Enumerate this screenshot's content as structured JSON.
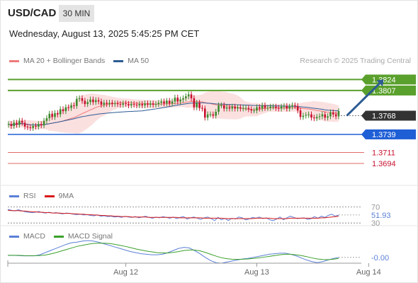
{
  "header": {
    "symbol": "USD/CAD",
    "timeframe": "30 MIN",
    "datetime": "Wednesday, August 13, 2025 5:45:25 PM CET",
    "research": "Research © 2025 Trading Central"
  },
  "legends": {
    "price": [
      {
        "label": "MA 20 + Bollinger Bands",
        "color": "#f07a7a"
      },
      {
        "label": "MA 50",
        "color": "#2d5b94"
      }
    ],
    "rsi": [
      {
        "label": "RSI",
        "color": "#5b7fd6"
      },
      {
        "label": "9MA",
        "color": "#d81a1a"
      }
    ],
    "macd": [
      {
        "label": "MACD",
        "color": "#5b7fd6"
      },
      {
        "label": "MACD Signal",
        "color": "#3aa02a"
      }
    ]
  },
  "colors": {
    "up": "#3c8a2e",
    "down": "#c8102e",
    "band": "#f9d6d6",
    "resistance": "#5aa02c",
    "current": "#333333",
    "support_blue": "#1f5fd6",
    "support_red": "#e06a6a",
    "arrow": "#2d5b94"
  },
  "chart_data": [
    {
      "type": "candlestick",
      "title": "USD/CAD",
      "ylim": [
        1.366,
        1.3842
      ],
      "x_ticks": [
        {
          "label": "Aug 12",
          "index": 43
        },
        {
          "label": "Aug 13",
          "index": 91
        },
        {
          "label": "Aug 14",
          "index": 132
        }
      ],
      "levels": [
        {
          "value": 1.3824,
          "label": "1.3824",
          "kind": "resistance"
        },
        {
          "value": 1.3807,
          "label": "1.3807",
          "kind": "resistance"
        },
        {
          "value": 1.3768,
          "label": "1.3768",
          "kind": "current"
        },
        {
          "value": 1.3739,
          "label": "1.3739",
          "kind": "support_blue"
        },
        {
          "value": 1.3711,
          "label": "1.3711",
          "kind": "support_red"
        },
        {
          "value": 1.3694,
          "label": "1.3694",
          "kind": "support_red"
        }
      ],
      "closes": [
        1.3755,
        1.3752,
        1.3757,
        1.3754,
        1.376,
        1.3757,
        1.3751,
        1.375,
        1.3749,
        1.3752,
        1.3751,
        1.3755,
        1.3753,
        1.376,
        1.3764,
        1.3771,
        1.3766,
        1.3772,
        1.377,
        1.3778,
        1.3775,
        1.3781,
        1.378,
        1.3784,
        1.3783,
        1.3794,
        1.3795,
        1.3791,
        1.3786,
        1.3789,
        1.3793,
        1.3789,
        1.3792,
        1.379,
        1.3785,
        1.3788,
        1.3786,
        1.3788,
        1.3786,
        1.3787,
        1.3786,
        1.3785,
        1.3787,
        1.3786,
        1.3784,
        1.3786,
        1.3785,
        1.3784,
        1.3786,
        1.3784,
        1.3787,
        1.3785,
        1.3787,
        1.3785,
        1.3786,
        1.3788,
        1.379,
        1.3787,
        1.3791,
        1.3787,
        1.379,
        1.3796,
        1.379,
        1.3793,
        1.3795,
        1.3798,
        1.3801,
        1.3795,
        1.3781,
        1.3788,
        1.378,
        1.3779,
        1.3765,
        1.377,
        1.377,
        1.3768,
        1.3774,
        1.3784,
        1.3784,
        1.3779,
        1.3781,
        1.3779,
        1.3782,
        1.3779,
        1.3781,
        1.3779,
        1.378,
        1.378,
        1.3778,
        1.3776,
        1.3776,
        1.3781,
        1.3779,
        1.3784,
        1.378,
        1.378,
        1.3782,
        1.3782,
        1.378,
        1.3779,
        1.3782,
        1.3783,
        1.3779,
        1.3782,
        1.3784,
        1.3783,
        1.3776,
        1.3766,
        1.3768,
        1.3769,
        1.377,
        1.3765,
        1.3764,
        1.3766,
        1.3767,
        1.377,
        1.3765,
        1.3767,
        1.3773,
        1.377,
        1.3767,
        1.3775
      ],
      "opens": [
        1.3754,
        1.3755,
        1.3752,
        1.3757,
        1.3754,
        1.376,
        1.3757,
        1.3751,
        1.375,
        1.3749,
        1.3752,
        1.3751,
        1.3755,
        1.3753,
        1.376,
        1.3764,
        1.3771,
        1.3766,
        1.3772,
        1.377,
        1.3778,
        1.3775,
        1.3781,
        1.378,
        1.3784,
        1.3783,
        1.3794,
        1.3795,
        1.3791,
        1.3786,
        1.3789,
        1.3793,
        1.3789,
        1.3792,
        1.379,
        1.3785,
        1.3788,
        1.3786,
        1.3788,
        1.3786,
        1.3787,
        1.3786,
        1.3785,
        1.3787,
        1.3786,
        1.3784,
        1.3786,
        1.3785,
        1.3784,
        1.3786,
        1.3784,
        1.3787,
        1.3785,
        1.3787,
        1.3785,
        1.3786,
        1.3788,
        1.379,
        1.3787,
        1.3791,
        1.3787,
        1.379,
        1.3796,
        1.379,
        1.3793,
        1.3795,
        1.3798,
        1.3801,
        1.3795,
        1.3781,
        1.3788,
        1.378,
        1.3779,
        1.3765,
        1.377,
        1.377,
        1.3768,
        1.3774,
        1.3784,
        1.3784,
        1.3779,
        1.3781,
        1.3779,
        1.3782,
        1.3779,
        1.3781,
        1.3779,
        1.378,
        1.378,
        1.3778,
        1.3776,
        1.3776,
        1.3781,
        1.3779,
        1.3784,
        1.378,
        1.378,
        1.3782,
        1.3782,
        1.378,
        1.3779,
        1.3782,
        1.3783,
        1.3779,
        1.3782,
        1.3784,
        1.3783,
        1.3776,
        1.3766,
        1.3768,
        1.3769,
        1.377,
        1.3765,
        1.3764,
        1.3766,
        1.3767,
        1.377,
        1.3765,
        1.3767,
        1.3773,
        1.377,
        1.3767
      ],
      "forecast": [
        {
          "index": 124,
          "value": 1.3768
        },
        {
          "index": 136,
          "value": 1.3818
        }
      ]
    },
    {
      "type": "line",
      "title": "RSI",
      "ylim": [
        25,
        80
      ],
      "y_ticks": [
        70,
        30
      ],
      "last_value": "51.93",
      "series": [
        {
          "name": "RSI",
          "color": "#5b7fd6",
          "values": [
            64,
            62,
            60,
            63,
            61,
            58,
            57,
            56,
            57,
            59,
            56,
            55,
            57,
            55,
            56,
            54,
            53,
            55,
            54,
            52,
            51,
            52,
            50,
            51,
            49,
            48,
            50,
            47,
            48,
            46,
            47,
            45,
            46,
            44,
            47,
            45,
            44,
            46,
            43,
            45,
            47,
            44,
            42,
            45,
            43,
            46,
            44,
            42,
            45,
            41,
            44,
            46,
            40,
            43,
            45,
            42,
            39,
            43,
            45,
            41,
            36,
            44,
            38,
            42,
            36,
            42,
            40,
            45,
            43,
            38,
            40,
            44,
            42,
            45,
            41,
            43,
            38,
            36,
            40,
            45,
            38,
            43,
            47,
            44,
            41,
            42,
            43,
            39,
            41,
            46,
            42,
            47,
            44,
            49,
            52,
            47,
            50
          ]
        },
        {
          "name": "9MA",
          "color": "#d81a1a",
          "values": [
            62,
            61,
            61,
            61,
            60,
            60,
            59,
            58,
            58,
            57,
            57,
            56,
            56,
            55,
            55,
            55,
            54,
            54,
            54,
            53,
            53,
            52,
            52,
            51,
            51,
            50,
            50,
            49,
            49,
            48,
            48,
            47,
            47,
            46,
            46,
            46,
            45,
            45,
            45,
            45,
            45,
            44,
            44,
            44,
            44,
            44,
            44,
            44,
            44,
            44,
            43,
            43,
            43,
            43,
            43,
            43,
            43,
            42,
            42,
            42,
            42,
            42,
            42,
            41,
            41,
            41,
            41,
            41,
            41,
            41,
            41,
            41,
            42,
            42,
            42,
            42,
            42,
            41,
            41,
            41,
            41,
            41,
            42,
            42,
            42,
            42,
            42,
            42,
            42,
            42,
            42,
            43,
            43,
            44,
            45,
            46,
            47
          ]
        }
      ]
    },
    {
      "type": "line",
      "title": "MACD",
      "last_value": "-0.00",
      "series": [
        {
          "name": "MACD",
          "color": "#5b7fd6",
          "values": [
            0.1,
            0.1,
            0.05,
            0,
            0,
            0,
            0.2,
            0.6,
            1.0,
            1.4,
            1.8,
            2.2,
            2.5,
            2.6,
            2.8,
            2.9,
            2.8,
            2.6,
            2.3,
            2.0,
            1.7,
            1.4,
            1.1,
            0.8,
            0.6,
            0.4,
            0.3,
            0.2,
            0.2,
            0.3,
            0.6,
            1.0,
            1.4,
            1.6,
            1.5,
            1.0,
            0.4,
            -0.3,
            -0.9,
            -1.3,
            -1.4,
            -1.2,
            -1.0,
            -0.8,
            -0.6,
            -0.5,
            -0.3,
            -0.1,
            0.1,
            0.3,
            0.4,
            0.5,
            0.5,
            0.3,
            0.0,
            -0.4,
            -0.8,
            -1.1,
            -1.3,
            -1.1,
            -0.8,
            -0.5,
            -0.3
          ]
        },
        {
          "name": "MACD Signal",
          "color": "#3aa02a",
          "values": [
            0.1,
            0.1,
            0.1,
            0.05,
            0.03,
            0.02,
            0.05,
            0.15,
            0.35,
            0.6,
            0.9,
            1.2,
            1.5,
            1.8,
            2.0,
            2.2,
            2.35,
            2.4,
            2.4,
            2.35,
            2.2,
            2.0,
            1.8,
            1.55,
            1.3,
            1.1,
            0.9,
            0.75,
            0.6,
            0.55,
            0.55,
            0.65,
            0.8,
            1.0,
            1.1,
            1.1,
            0.95,
            0.65,
            0.3,
            -0.05,
            -0.35,
            -0.55,
            -0.65,
            -0.68,
            -0.65,
            -0.6,
            -0.5,
            -0.4,
            -0.25,
            -0.1,
            0.05,
            0.2,
            0.3,
            0.3,
            0.2,
            0.05,
            -0.15,
            -0.4,
            -0.6,
            -0.7,
            -0.72,
            -0.65,
            -0.5
          ]
        }
      ]
    }
  ]
}
